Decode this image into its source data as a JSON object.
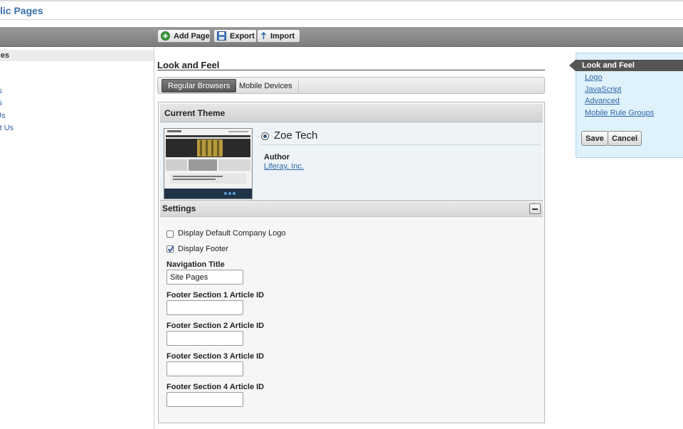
{
  "header": {
    "title": "lic Pages"
  },
  "toolbar": {
    "add_page": "Add Page",
    "export": "Export",
    "import": "Import"
  },
  "tree": {
    "header": "ges",
    "items": [
      "s",
      "rs",
      "rs",
      "Us",
      "ct Us"
    ]
  },
  "main": {
    "heading": "Look and Feel",
    "tabs": [
      "Regular Browsers",
      "Mobile Devices"
    ],
    "current_theme_label": "Current Theme",
    "theme_name": "Zoe Tech",
    "author_label": "Author",
    "author_value": "Liferay, Inc."
  },
  "settings": {
    "label": "Settings",
    "checkbox_logo": {
      "label": "Display Default Company Logo",
      "checked": false
    },
    "checkbox_footer": {
      "label": "Display Footer",
      "checked": true
    },
    "navigation_title_label": "Navigation Title",
    "navigation_title_value": "Site Pages",
    "footer1_label": "Footer Section 1 Article ID",
    "footer2_label": "Footer Section 2 Article ID",
    "footer3_label": "Footer Section 3 Article ID",
    "footer4_label": "Footer Section 4 Article ID",
    "footer1_value": "",
    "footer2_value": "",
    "footer3_value": "",
    "footer4_value": ""
  },
  "right_nav": {
    "active": "Look and Feel",
    "links": [
      "Logo",
      "JavaScript",
      "Advanced",
      "Mobile Rule Groups"
    ],
    "save": "Save",
    "cancel": "Cancel"
  },
  "icons": {
    "add_page": "add-icon",
    "export": "floppy-disk-icon",
    "import": "arrow-up-icon",
    "collapse": "minus-icon"
  },
  "colors": {
    "link": "#2f67a6",
    "toolbar": "#888888",
    "right_panel_bg": "#dff1fb",
    "active_tab": "#575757"
  }
}
